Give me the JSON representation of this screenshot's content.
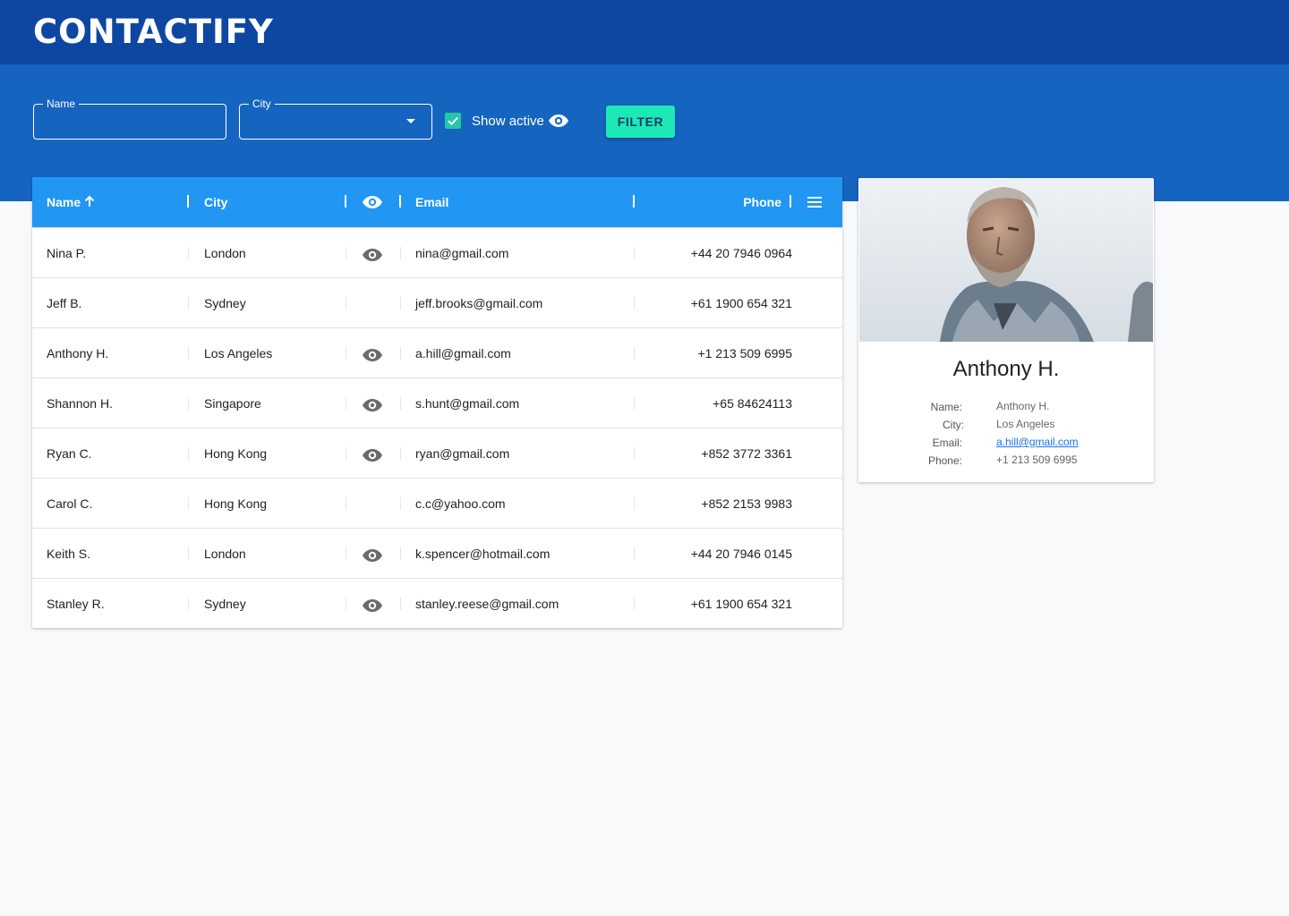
{
  "app": {
    "title": "CONTACTIFY"
  },
  "filters": {
    "name_label": "Name",
    "name_value": "",
    "city_label": "City",
    "city_value": "",
    "show_active_label": "Show active",
    "show_active_checked": true,
    "filter_button": "FILTER"
  },
  "table": {
    "headers": {
      "name": "Name",
      "city": "City",
      "email": "Email",
      "phone": "Phone"
    },
    "sort": {
      "column": "Name",
      "direction": "ascending"
    },
    "rows": [
      {
        "name": "Nina P.",
        "city": "London",
        "active": true,
        "email": "nina@gmail.com",
        "phone": "+44 20 7946 0964"
      },
      {
        "name": "Jeff B.",
        "city": "Sydney",
        "active": false,
        "email": "jeff.brooks@gmail.com",
        "phone": "+61 1900 654 321"
      },
      {
        "name": "Anthony H.",
        "city": "Los Angeles",
        "active": true,
        "email": "a.hill@gmail.com",
        "phone": "+1 213 509 6995"
      },
      {
        "name": "Shannon H.",
        "city": "Singapore",
        "active": true,
        "email": "s.hunt@gmail.com",
        "phone": "+65 84624113"
      },
      {
        "name": "Ryan C.",
        "city": "Hong Kong",
        "active": true,
        "email": "ryan@gmail.com",
        "phone": "+852 3772 3361"
      },
      {
        "name": "Carol C.",
        "city": "Hong Kong",
        "active": false,
        "email": "c.c@yahoo.com",
        "phone": "+852 2153 9983"
      },
      {
        "name": "Keith S.",
        "city": "London",
        "active": true,
        "email": "k.spencer@hotmail.com",
        "phone": "+44 20 7946 0145"
      },
      {
        "name": "Stanley R.",
        "city": "Sydney",
        "active": true,
        "email": "stanley.reese@gmail.com",
        "phone": "+61 1900 654 321"
      }
    ]
  },
  "detail": {
    "name": "Anthony H.",
    "labels": {
      "name": "Name:",
      "city": "City:",
      "email": "Email:",
      "phone": "Phone:"
    },
    "values": {
      "name": "Anthony H.",
      "city": "Los Angeles",
      "email": "a.hill@gmail.com",
      "phone": "+1 213 509 6995"
    }
  },
  "icons": {
    "eye": "eye-icon",
    "sort": "arrow-up-icon",
    "menu": "menu-icon",
    "check": "check-icon",
    "dropdown": "arrow-drop-down-icon"
  },
  "colors": {
    "appbar": "#0d47a1",
    "filterbar": "#1565c0",
    "table_header": "#2196f3",
    "filter_button": "#1de9b6",
    "checkbox": "#26c6a6",
    "link": "#1a73e8"
  }
}
